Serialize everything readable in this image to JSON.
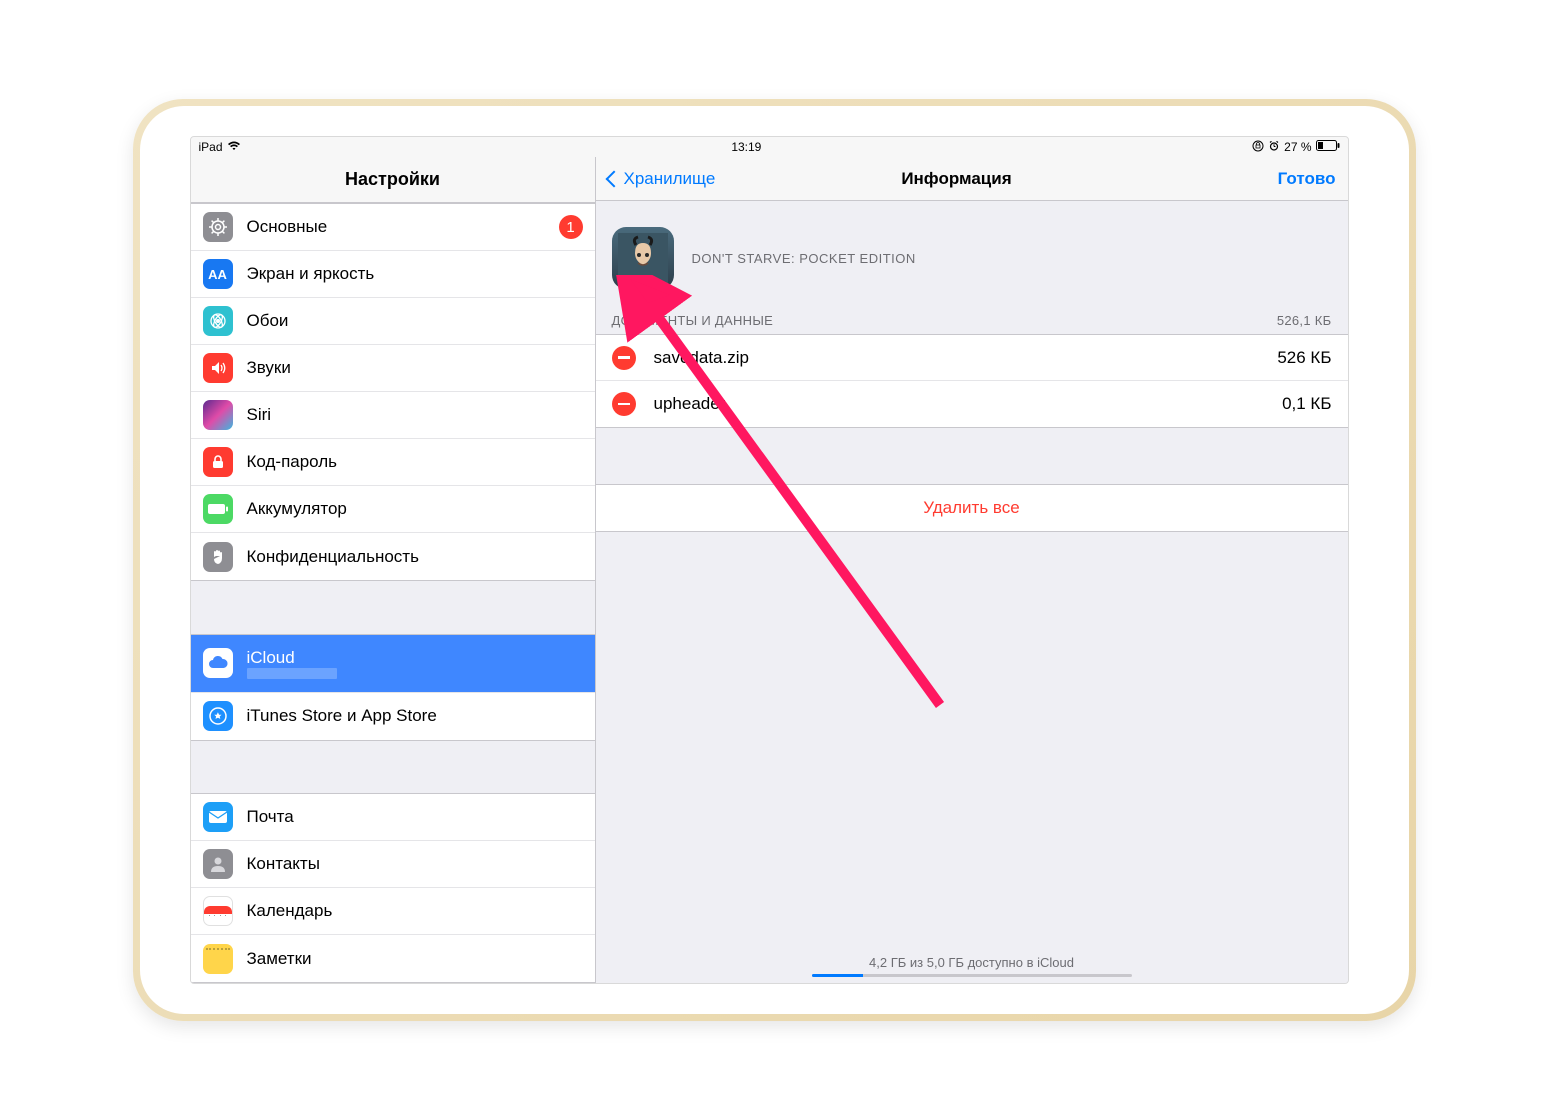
{
  "statusbar": {
    "device": "iPad",
    "time": "13:19",
    "battery": "27 %"
  },
  "sidebar": {
    "title": "Настройки",
    "group1": [
      {
        "key": "general",
        "label": "Основные",
        "badge": "1"
      },
      {
        "key": "display",
        "label": "Экран и яркость"
      },
      {
        "key": "wallpaper",
        "label": "Обои"
      },
      {
        "key": "sounds",
        "label": "Звуки"
      },
      {
        "key": "siri",
        "label": "Siri"
      },
      {
        "key": "passcode",
        "label": "Код-пароль"
      },
      {
        "key": "battery",
        "label": "Аккумулятор"
      },
      {
        "key": "privacy",
        "label": "Конфиденциальность"
      }
    ],
    "group2": [
      {
        "key": "icloud",
        "label": "iCloud",
        "sublabel": ""
      },
      {
        "key": "itunes",
        "label": "iTunes Store и App Store"
      }
    ],
    "group3": [
      {
        "key": "mail",
        "label": "Почта"
      },
      {
        "key": "contacts",
        "label": "Контакты"
      },
      {
        "key": "calendar",
        "label": "Календарь"
      },
      {
        "key": "notes",
        "label": "Заметки"
      }
    ]
  },
  "detail": {
    "back": "Хранилище",
    "title": "Информация",
    "done": "Готово",
    "app_name": "DON'T STARVE: POCKET EDITION",
    "section": {
      "title": "ДОКУМЕНТЫ И ДАННЫЕ",
      "size": "526,1 КБ"
    },
    "docs": [
      {
        "name": "savedata.zip",
        "size": "526 КБ"
      },
      {
        "name": "upheader",
        "size": "0,1 КБ"
      }
    ],
    "delete_all": "Удалить все",
    "footer": "4,2 ГБ из 5,0 ГБ доступно в iCloud"
  }
}
